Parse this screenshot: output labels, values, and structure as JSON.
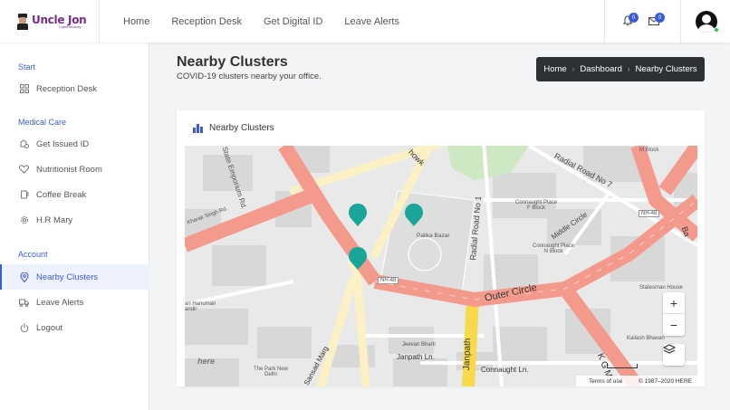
{
  "brand": {
    "name": "Uncle Jon",
    "sub": "Cybersecurity"
  },
  "topnav": [
    "Home",
    "Reception Desk",
    "Get Digital ID",
    "Leave Alerts"
  ],
  "notifications": {
    "bell_count": "0",
    "mail_count": "0"
  },
  "sidebar": {
    "sections": [
      {
        "title": "Start",
        "items": [
          {
            "label": "Reception Desk",
            "icon": "dashboard-icon"
          }
        ]
      },
      {
        "title": "Medical Care",
        "items": [
          {
            "label": "Get Issued ID",
            "icon": "id-icon"
          },
          {
            "label": "Nutritionist Room",
            "icon": "heart-icon"
          },
          {
            "label": "Coffee Break",
            "icon": "coffee-icon"
          },
          {
            "label": "H.R Mary",
            "icon": "gear-icon"
          }
        ]
      },
      {
        "title": "Account",
        "items": [
          {
            "label": "Nearby Clusters",
            "icon": "location-pin-icon",
            "active": true
          },
          {
            "label": "Leave Alerts",
            "icon": "truck-icon"
          },
          {
            "label": "Logout",
            "icon": "power-icon"
          }
        ]
      }
    ]
  },
  "page": {
    "title": "Nearby Clusters",
    "subtitle": "COVID-19 clusters nearby your office."
  },
  "breadcrumb": [
    "Home",
    "Dashboard",
    "Nearby Clusters"
  ],
  "card": {
    "title": "Nearby Clusters"
  },
  "map": {
    "labels": {
      "state_emporium": "State Emporium Rd.",
      "radial7": "Radial Road No 7",
      "radial1": "Radial Road No 1",
      "outer_circle": "Outer Circle",
      "middle_circle": "Middle Circle",
      "janpath": "Janpath",
      "janpath_ln": "Janpath Ln.",
      "connaught_ln": "Connaught Ln.",
      "sansad_marg": "Sansad Marg",
      "palika_bazar": "Palika Bazar",
      "cp_f": "Connaught Place\nF Block",
      "cp_n": "Connaught Place\nN Block",
      "m_block": "M Block",
      "statesman": "Statesman House",
      "kailash": "Kailash Bhavan",
      "jeevan": "Jeevan Bharti",
      "park": "The Park New\nDelhi",
      "hanuman": "an Hanuman\nandir",
      "kharak": "Kharak Singh Rd.",
      "nh48a": "NH-48",
      "nh48b": "NH-48",
      "kg": "K G M",
      "chowk": "howk",
      "b": "Ba"
    },
    "terms": "Terms of use",
    "copyright": "© 1987–2020 HERE",
    "here": "here"
  },
  "colors": {
    "accent": "#3b5bdb",
    "pin": "#1aa59a",
    "major_road": "#f49a8c",
    "minor_road": "#fbf1c4",
    "park": "#cfe8c4"
  }
}
